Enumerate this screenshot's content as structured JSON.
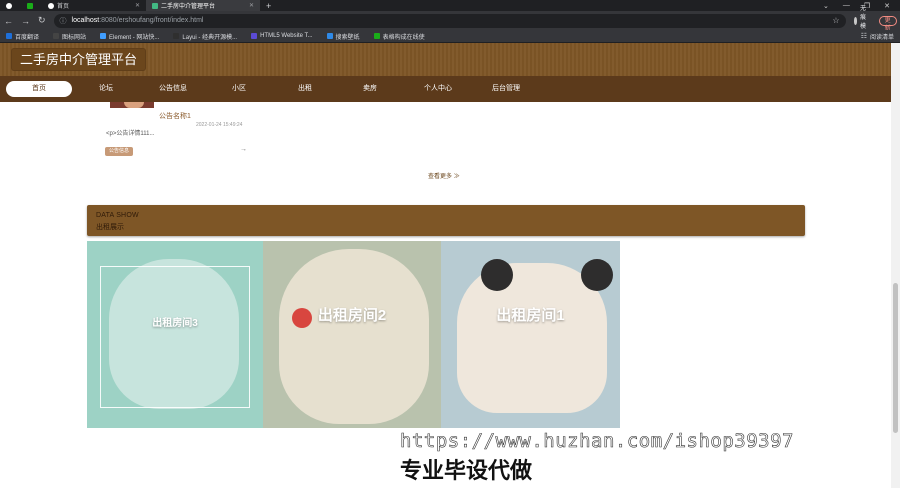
{
  "browser": {
    "tabs": [
      {
        "title": ""
      },
      {
        "title": ""
      },
      {
        "title": "首页"
      },
      {
        "title": "二手房中介管理平台"
      }
    ],
    "address": {
      "host": "localhost",
      "path": ":8080/ershoufang/front/index.html"
    },
    "profile_label": "无痕模式",
    "update_label": "更新",
    "bookmarks": [
      {
        "label": "百度翻译",
        "color": "#1e6fd9"
      },
      {
        "label": "图标网站",
        "color": "#444444"
      },
      {
        "label": "Element - 网站快...",
        "color": "#409eff"
      },
      {
        "label": "Layui - 经典开源模...",
        "color": "#2f2f2f"
      },
      {
        "label": "HTML5 Website T...",
        "color": "#5b4bd6"
      },
      {
        "label": "搜索壁纸",
        "color": "#2f8ae8"
      },
      {
        "label": "表格构成在线使",
        "color": "#1aad19"
      }
    ],
    "reading_list": "阅读清单"
  },
  "site": {
    "title": "二手房中介管理平台",
    "nav": [
      {
        "label": "首页",
        "active": true
      },
      {
        "label": "论坛"
      },
      {
        "label": "公告信息"
      },
      {
        "label": "小区"
      },
      {
        "label": "出租"
      },
      {
        "label": "卖房"
      },
      {
        "label": "个人中心"
      },
      {
        "label": "后台管理"
      }
    ]
  },
  "notice": {
    "title": "公告名称1",
    "time": "2022-01-24 15:49:24",
    "body": "<p>公告详情111...",
    "tag": "公告信息",
    "more": "→"
  },
  "view_more": "查看更多 ≫",
  "data_show": {
    "en": "DATA SHOW",
    "cn": "出租展示"
  },
  "rentals": [
    {
      "label": "出租房间3"
    },
    {
      "label": "出租房间2"
    },
    {
      "label": "出租房间1"
    }
  ],
  "overlay": {
    "watermark": "https://www.huzhan.com/ishop39397",
    "promo": "专业毕设代做"
  }
}
